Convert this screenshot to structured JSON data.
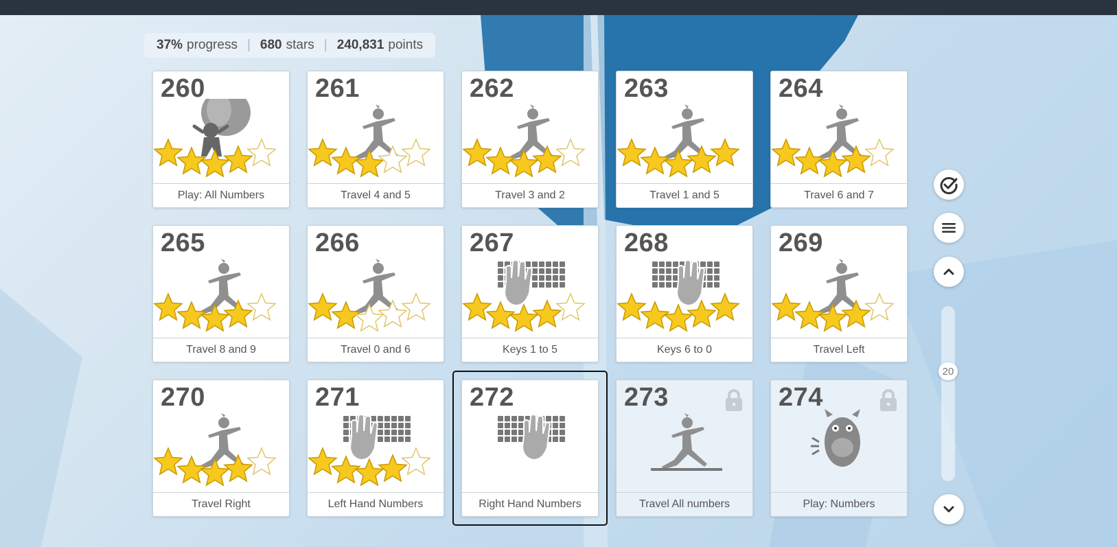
{
  "stats": {
    "progress_value": "37%",
    "progress_label": "progress",
    "stars_value": "680",
    "stars_label": "stars",
    "points_value": "240,831",
    "points_label": "points"
  },
  "lessons": [
    {
      "num": "260",
      "label": "Play: All Numbers",
      "stars": 4,
      "icon": "balloon-ninja-icon",
      "locked": false
    },
    {
      "num": "261",
      "label": "Travel 4 and 5",
      "stars": 3,
      "icon": "yoga-pose-icon",
      "locked": false
    },
    {
      "num": "262",
      "label": "Travel 3 and 2",
      "stars": 4,
      "icon": "yoga-pose-icon",
      "locked": false
    },
    {
      "num": "263",
      "label": "Travel 1 and 5",
      "stars": 5,
      "icon": "yoga-pose-icon",
      "locked": false
    },
    {
      "num": "264",
      "label": "Travel 6 and 7",
      "stars": 4,
      "icon": "yoga-pose-icon",
      "locked": false
    },
    {
      "num": "265",
      "label": "Travel 8 and 9",
      "stars": 4,
      "icon": "yoga-pose-icon",
      "locked": false
    },
    {
      "num": "266",
      "label": "Travel 0 and 6",
      "stars": 2,
      "icon": "yoga-pose-icon",
      "locked": false
    },
    {
      "num": "267",
      "label": "Keys 1 to 5",
      "stars": 4,
      "icon": "left-hand-keyboard-icon",
      "locked": false
    },
    {
      "num": "268",
      "label": "Keys 6 to 0",
      "stars": 5,
      "icon": "right-hand-keyboard-icon",
      "locked": false
    },
    {
      "num": "269",
      "label": "Travel Left",
      "stars": 4,
      "icon": "yoga-pose-icon",
      "locked": false
    },
    {
      "num": "270",
      "label": "Travel Right",
      "stars": 4,
      "icon": "yoga-pose-icon",
      "locked": false
    },
    {
      "num": "271",
      "label": "Left Hand Numbers",
      "stars": 4,
      "icon": "left-hand-keyboard-icon",
      "locked": false
    },
    {
      "num": "272",
      "label": "Right Hand Numbers",
      "stars": 0,
      "icon": "right-hand-keyboard-icon",
      "locked": false,
      "selected": true
    },
    {
      "num": "273",
      "label": "Travel All numbers",
      "stars": 0,
      "icon": "yoga-pose-icon",
      "locked": true
    },
    {
      "num": "274",
      "label": "Play: Numbers",
      "stars": 0,
      "icon": "monster-icon",
      "locked": true
    }
  ],
  "sidebar": {
    "check_icon": "check-circle-icon",
    "menu_icon": "menu-icon",
    "up_icon": "chevron-up-icon",
    "down_icon": "chevron-down-icon",
    "slider_value": "20"
  },
  "colors": {
    "star_fill": "#f7c81e",
    "star_empty": "#ffffff",
    "figure_gray": "#8f8f8f",
    "topbar": "#2a3440"
  }
}
